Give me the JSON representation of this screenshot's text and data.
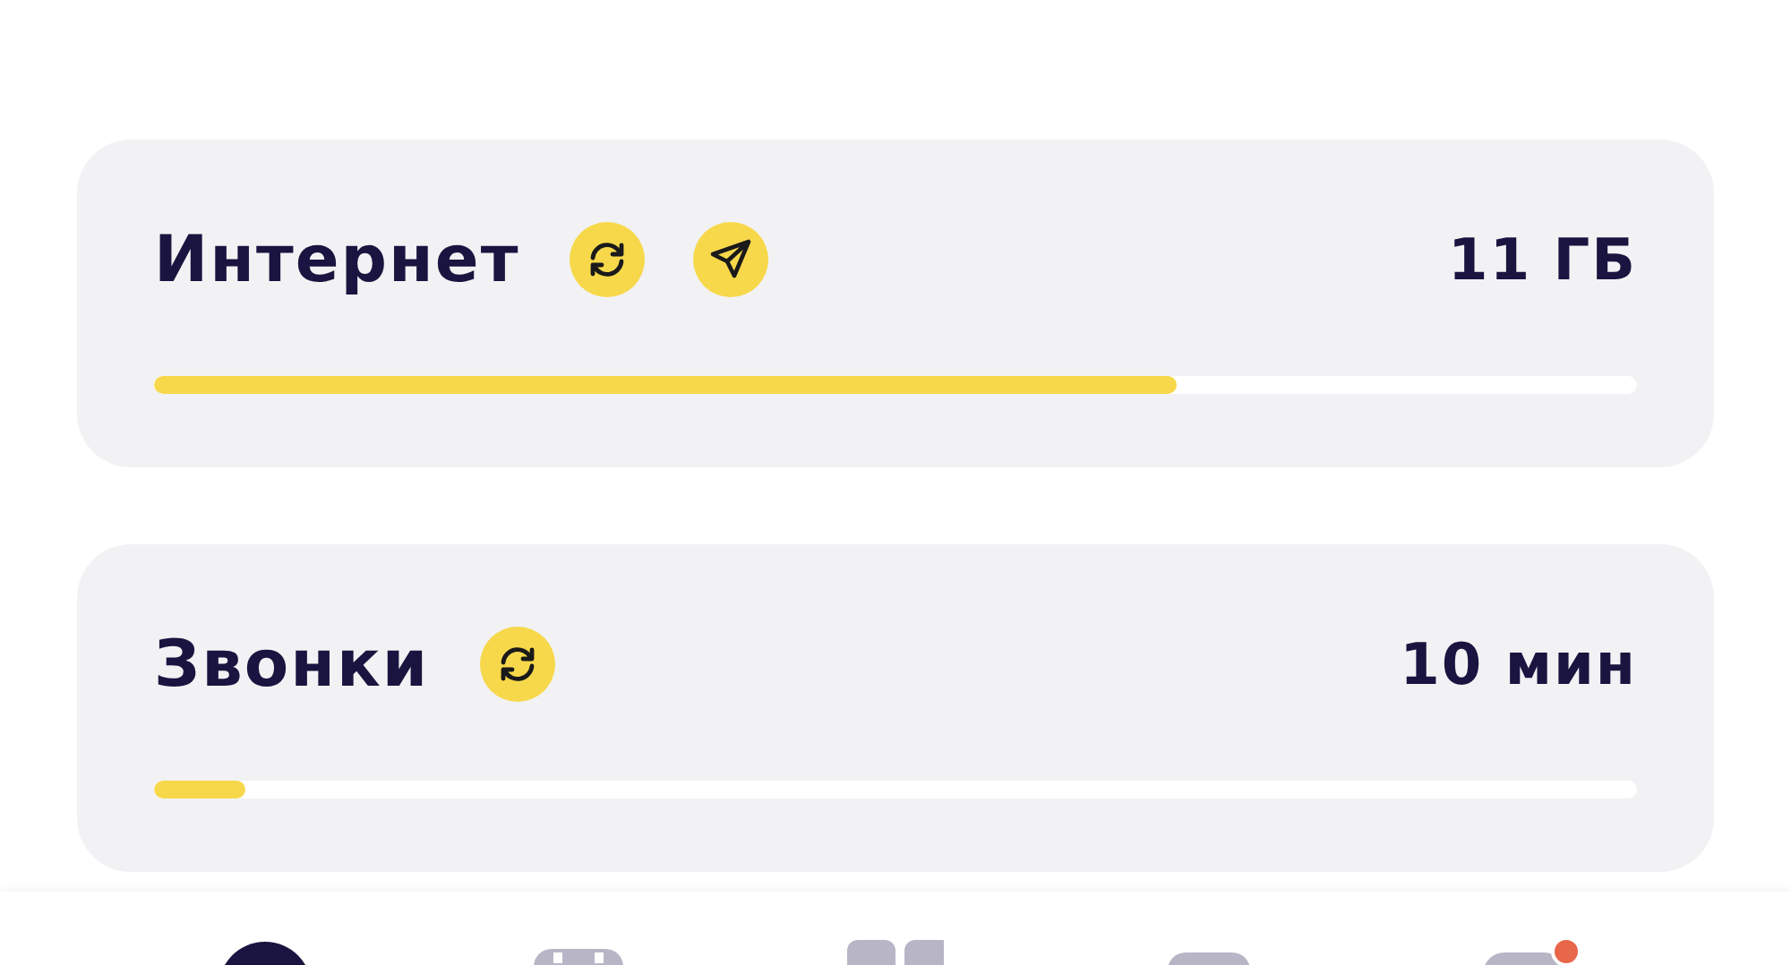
{
  "balances": [
    {
      "title": "Интернет",
      "actions": [
        {
          "kind": "refresh"
        },
        {
          "kind": "send"
        }
      ],
      "amount": "11 ГБ",
      "level": 0.69
    },
    {
      "title": "Звонки",
      "actions": [
        {
          "kind": "refresh"
        }
      ],
      "amount": "10 мин",
      "level": 0.062
    }
  ],
  "nav": [
    {
      "kind": "circle",
      "selected": true,
      "notification": false
    },
    {
      "kind": "calendar",
      "selected": false,
      "notification": false
    },
    {
      "kind": "grid",
      "selected": false,
      "notification": false
    },
    {
      "kind": "box",
      "selected": false,
      "notification": false
    },
    {
      "kind": "chat",
      "selected": false,
      "notification": true
    }
  ]
}
